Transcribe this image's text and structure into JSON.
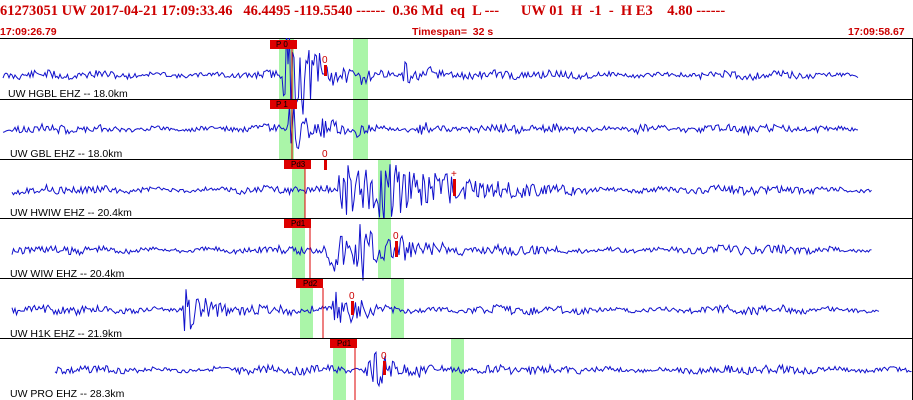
{
  "header": {
    "title": "61273051 UW 2017-04-21 17:09:33.46   46.4495 -119.5540 ------  0.36 Md  eq  L ---      UW 01  H  -1  -  H E3    4.80 ------",
    "start_time": "17:09:26.79",
    "timespan": "Timespan=  32 s",
    "end_time": "17:09:58.67"
  },
  "colors": {
    "trace": "#1010cc",
    "window": "#aaf5a8",
    "pick": "#dd0000",
    "text_header": "#cc0000",
    "divider": "#000000"
  },
  "traces": [
    {
      "label": "UW HGBL EHZ -- 18.0km",
      "pick_label": "P 0",
      "amp_label": "0"
    },
    {
      "label": "UW GBL EHZ -- 18.0km",
      "pick_label": "P 1",
      "amp_label": "0"
    },
    {
      "label": "UW HWIW EHZ -- 20.4km",
      "pick_label": "Pd3",
      "amp_label": "+"
    },
    {
      "label": "UW WIW EHZ -- 20.4km",
      "pick_label": "Pd1",
      "amp_label": "0"
    },
    {
      "label": "UW H1K EHZ -- 21.9km",
      "pick_label": "Pd2",
      "amp_label": "0"
    },
    {
      "label": "UW PRO EHZ -- 28.3km",
      "pick_label": "Pd1",
      "amp_label": "0"
    }
  ]
}
